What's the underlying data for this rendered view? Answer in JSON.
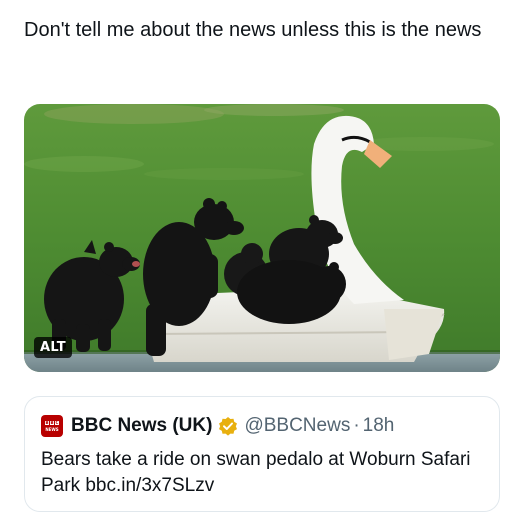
{
  "post": {
    "text": "Don't tell me about the news unless this is the news"
  },
  "media": {
    "alt_badge": "ALT",
    "content": "photo"
  },
  "quote": {
    "logo_letters": [
      "B",
      "B",
      "C"
    ],
    "logo_word": "NEWS",
    "display_name": "BBC News (UK)",
    "verified_icon": "verified-badge-icon",
    "verified_color": "#e8b00f",
    "handle": "@BBCNews",
    "separator": "·",
    "time": "18h",
    "body": "Bears take a ride on swan pedalo at Woburn Safari Park bbc.in/3x7SLzv"
  }
}
